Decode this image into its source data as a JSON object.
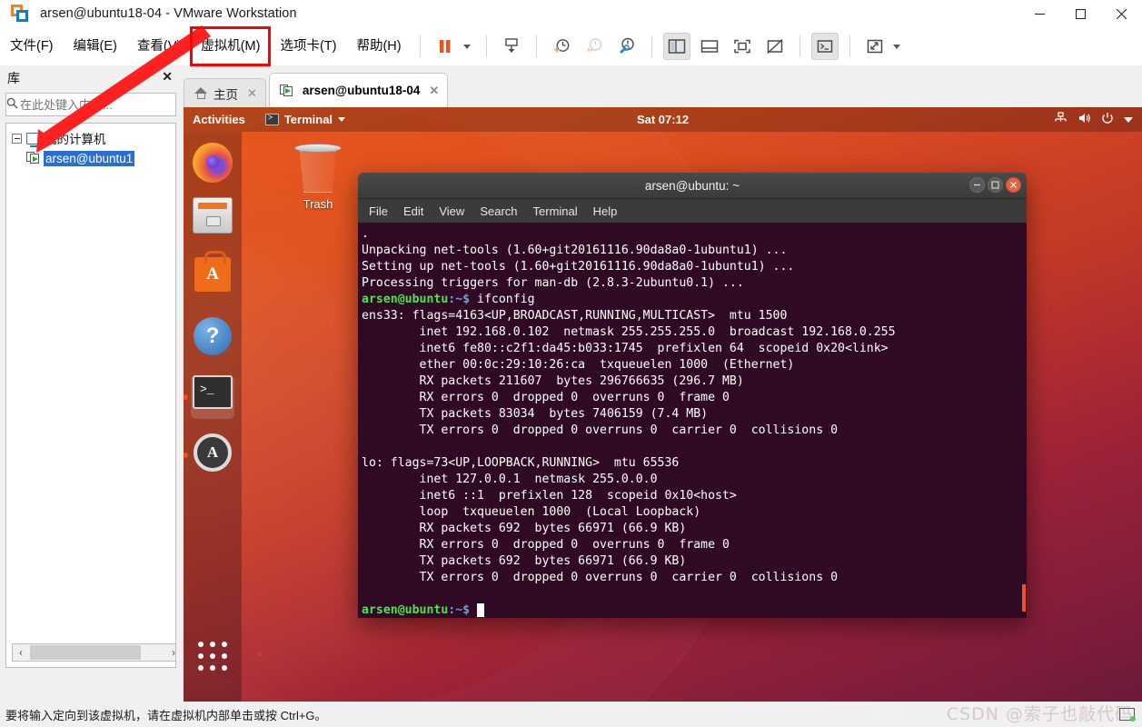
{
  "window": {
    "title": "arsen@ubuntu18-04 - VMware Workstation",
    "logo_icon": "vmware-logo-icon",
    "minimize_label": "—",
    "maximize_label": "☐",
    "close_label": "✕"
  },
  "menubar": {
    "items": [
      {
        "label": "文件(F)",
        "accel": "F",
        "boxed": false
      },
      {
        "label": "编辑(E)",
        "accel": "E",
        "boxed": false
      },
      {
        "label": "查看(V)",
        "accel": "V",
        "boxed": false
      },
      {
        "label": "虚拟机(M)",
        "accel": "M",
        "boxed": true
      },
      {
        "label": "选项卡(T)",
        "accel": "T",
        "boxed": false
      },
      {
        "label": "帮助(H)",
        "accel": "H",
        "boxed": false
      }
    ],
    "highlight_color": "#ff0000"
  },
  "toolbar": {
    "buttons": [
      {
        "name": "suspend-icon",
        "tip": "挂起"
      },
      {
        "name": "suspend-dropdown-caret-icon",
        "tip": "挂起选项"
      },
      {
        "name": "power-snapshot-icon",
        "tip": "快照"
      },
      {
        "name": "take-snapshot-icon",
        "tip": "拍摄快照"
      },
      {
        "name": "revert-snapshot-icon",
        "tip": "恢复快照"
      },
      {
        "name": "snapshot-manager-icon",
        "tip": "快照管理器"
      },
      {
        "name": "show-library-icon",
        "tip": "显示或隐藏库"
      },
      {
        "name": "show-console-view-icon",
        "tip": "控制台视图"
      },
      {
        "name": "full-screen-icon",
        "tip": "全屏"
      },
      {
        "name": "unity-mode-icon",
        "tip": "Unity 模式"
      },
      {
        "name": "console-terminal-icon",
        "tip": "终端"
      },
      {
        "name": "stretch-guest-icon",
        "tip": "拉伸客户机"
      },
      {
        "name": "stretch-dropdown-caret-icon",
        "tip": "拉伸选项"
      }
    ]
  },
  "sidebar": {
    "title": "库",
    "close_label": "✕",
    "search_placeholder": "在此处键入内容...",
    "search_value": "",
    "tree": [
      {
        "label": "我的计算机",
        "level": 0,
        "selected": false,
        "icon": "my-computer-icon"
      },
      {
        "label": "arsen@ubuntu1",
        "level": 1,
        "selected": true,
        "icon": "vm-icon"
      }
    ],
    "hscroll_left": "‹",
    "hscroll_right": "›"
  },
  "tabs": [
    {
      "label": "主页",
      "icon": "home-icon",
      "active": false,
      "close": "✕"
    },
    {
      "label": "arsen@ubuntu18-04",
      "icon": "vm-icon",
      "active": true,
      "close": "✕"
    }
  ],
  "guest": {
    "topbar": {
      "activities": "Activities",
      "app_name": "Terminal",
      "app_icon": "terminal-icon",
      "clock": "Sat 07:12",
      "status_icons": [
        "network-icon",
        "volume-icon",
        "power-icon",
        "chevron-down-icon"
      ]
    },
    "dock": [
      {
        "name": "firefox-icon",
        "label": "Firefox",
        "running": false,
        "focused": false
      },
      {
        "name": "files-icon",
        "label": "Files",
        "running": false,
        "focused": false
      },
      {
        "name": "ubuntu-software-icon",
        "label": "Ubuntu Software",
        "running": false,
        "focused": false
      },
      {
        "name": "help-icon",
        "label": "Help",
        "running": false,
        "focused": false
      },
      {
        "name": "terminal-icon",
        "label": "Terminal",
        "running": true,
        "focused": true
      },
      {
        "name": "software-updater-icon",
        "label": "Software Updater",
        "running": true,
        "focused": false
      }
    ],
    "apps_grid_label": "Show Applications",
    "desktop_icons": [
      {
        "name": "trash-icon",
        "label": "Trash"
      }
    ],
    "terminal": {
      "title": "arsen@ubuntu: ~",
      "menu": [
        "File",
        "Edit",
        "View",
        "Search",
        "Terminal",
        "Help"
      ],
      "controls": {
        "minimize": "—",
        "maximize": "□",
        "close": "✕"
      },
      "prompt_user_host": "arsen@ubuntu",
      "prompt_path": ":~$",
      "lines": [
        ".",
        "Unpacking net-tools (1.60+git20161116.90da8a0-1ubuntu1) ...",
        "Setting up net-tools (1.60+git20161116.90da8a0-1ubuntu1) ...",
        "Processing triggers for man-db (2.8.3-2ubuntu0.1) ...",
        "@@PROMPT@@ ifconfig",
        "ens33: flags=4163<UP,BROADCAST,RUNNING,MULTICAST>  mtu 1500",
        "        inet 192.168.0.102  netmask 255.255.255.0  broadcast 192.168.0.255",
        "        inet6 fe80::c2f1:da45:b033:1745  prefixlen 64  scopeid 0x20<link>",
        "        ether 00:0c:29:10:26:ca  txqueuelen 1000  (Ethernet)",
        "        RX packets 211607  bytes 296766635 (296.7 MB)",
        "        RX errors 0  dropped 0  overruns 0  frame 0",
        "        TX packets 83034  bytes 7406159 (7.4 MB)",
        "        TX errors 0  dropped 0 overruns 0  carrier 0  collisions 0",
        "",
        "lo: flags=73<UP,LOOPBACK,RUNNING>  mtu 65536",
        "        inet 127.0.0.1  netmask 255.0.0.0",
        "        inet6 ::1  prefixlen 128  scopeid 0x10<host>",
        "        loop  txqueuelen 1000  (Local Loopback)",
        "        RX packets 692  bytes 66971 (66.9 KB)",
        "        RX errors 0  dropped 0  overruns 0  frame 0",
        "        TX packets 692  bytes 66971 (66.9 KB)",
        "        TX errors 0  dropped 0 overruns 0  carrier 0  collisions 0",
        "",
        "@@PROMPT@@ @@CURSOR@@"
      ]
    }
  },
  "statusbar": {
    "message": "要将输入定向到该虚拟机，请在虚拟机内部单击或按 Ctrl+G。",
    "watermark": "CSDN @索子也敲代码",
    "net_icon": "network-connected-icon"
  },
  "colors": {
    "accent_orange": "#e95420",
    "terminal_bg": "#300a24",
    "annotation_red": "#ff0000",
    "selection_blue": "#2a6fd0"
  }
}
